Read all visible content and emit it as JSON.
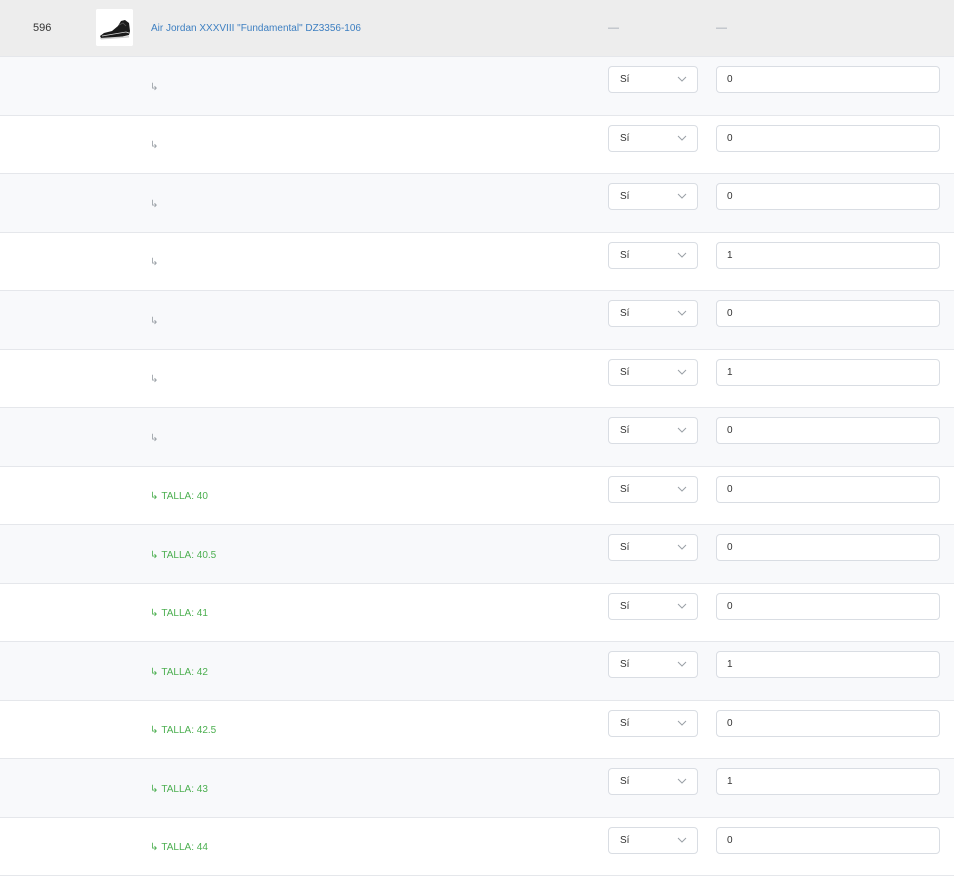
{
  "product": {
    "id": "596",
    "name": "Air Jordan XXXVIII \"Fundamental\" DZ3356-106",
    "thumbnail": "sneaker-image",
    "col_available": "—",
    "col_stock": "—"
  },
  "variants": [
    {
      "label": "",
      "available": "Sí",
      "stock": "0"
    },
    {
      "label": "",
      "available": "Sí",
      "stock": "0"
    },
    {
      "label": "",
      "available": "Sí",
      "stock": "0"
    },
    {
      "label": "",
      "available": "Sí",
      "stock": "1"
    },
    {
      "label": "",
      "available": "Sí",
      "stock": "0"
    },
    {
      "label": "",
      "available": "Sí",
      "stock": "1"
    },
    {
      "label": "",
      "available": "Sí",
      "stock": "0"
    },
    {
      "label": "TALLA: 40",
      "available": "Sí",
      "stock": "0"
    },
    {
      "label": "TALLA: 40.5",
      "available": "Sí",
      "stock": "0"
    },
    {
      "label": "TALLA: 41",
      "available": "Sí",
      "stock": "0"
    },
    {
      "label": "TALLA: 42",
      "available": "Sí",
      "stock": "1"
    },
    {
      "label": "TALLA: 42.5",
      "available": "Sí",
      "stock": "0"
    },
    {
      "label": "TALLA: 43",
      "available": "Sí",
      "stock": "1"
    },
    {
      "label": "TALLA: 44",
      "available": "Sí",
      "stock": "0"
    }
  ],
  "symbols": {
    "variant_arrow": "↳"
  },
  "colors": {
    "link": "#3d7fc1",
    "variant_green": "#4caf50",
    "variant_gray": "#9aa0a6"
  }
}
